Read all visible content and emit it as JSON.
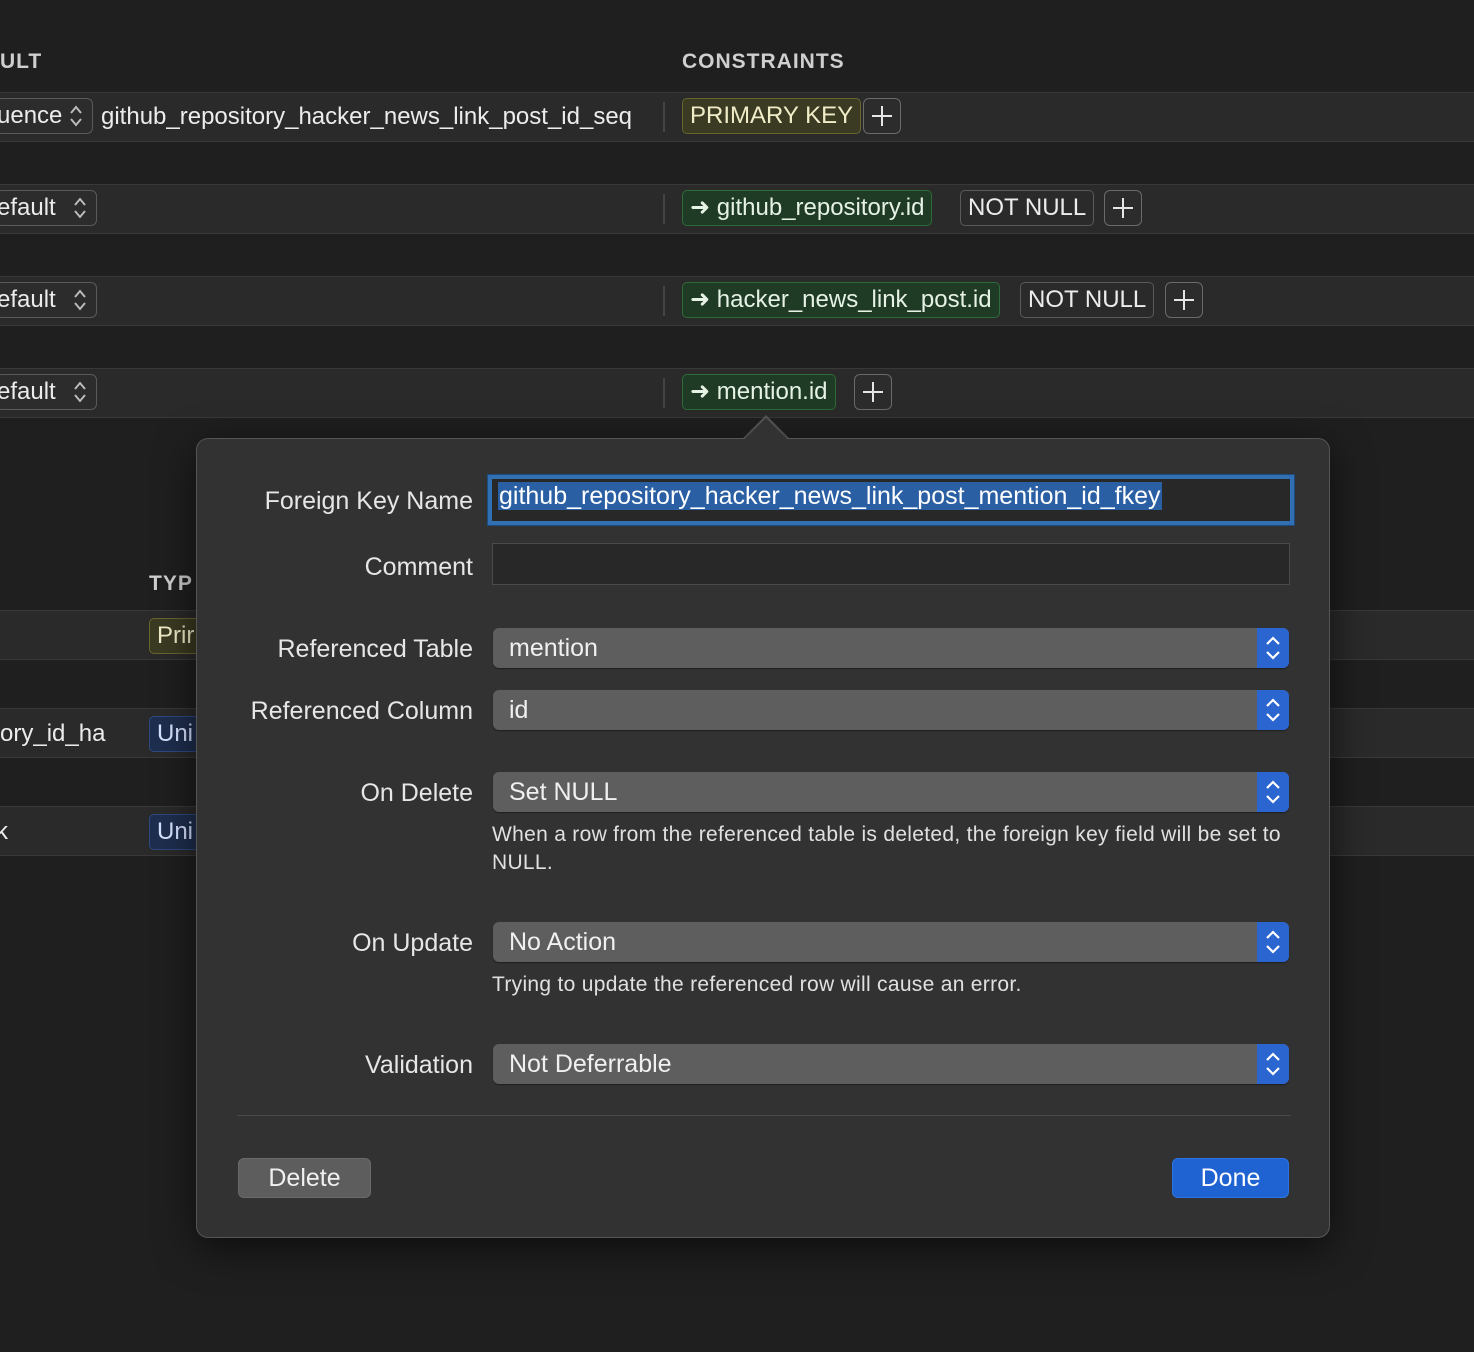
{
  "headers": {
    "default_col": "ULT",
    "constraints_col": "CONSTRAINTS",
    "type_col": "TYP"
  },
  "rows": [
    {
      "default_popup": "uence",
      "default_value": "github_repository_hacker_news_link_post_id_seq",
      "constraints": [
        {
          "kind": "pk",
          "label": "PRIMARY KEY"
        }
      ]
    },
    {
      "default_popup": "efault",
      "default_value": "",
      "constraints": [
        {
          "kind": "fk",
          "label": "➜ github_repository.id"
        },
        {
          "kind": "nn",
          "label": "NOT NULL"
        }
      ]
    },
    {
      "default_popup": "efault",
      "default_value": "",
      "constraints": [
        {
          "kind": "fk",
          "label": "➜ hacker_news_link_post.id"
        },
        {
          "kind": "nn",
          "label": "NOT NULL"
        }
      ]
    },
    {
      "default_popup": "efault",
      "default_value": "",
      "constraints": [
        {
          "kind": "fk",
          "label": "➜ mention.id"
        }
      ]
    }
  ],
  "indexes": {
    "rows": [
      {
        "name": "",
        "type": "Prir"
      },
      {
        "name": "ory_id_ha",
        "type": "Uni"
      },
      {
        "name": "k",
        "type": "Uni"
      }
    ]
  },
  "popover": {
    "fk_name_label": "Foreign Key Name",
    "fk_name_value": "github_repository_hacker_news_link_post_mention_id_fkey",
    "comment_label": "Comment",
    "comment_value": "",
    "ref_table_label": "Referenced Table",
    "ref_table_value": "mention",
    "ref_column_label": "Referenced Column",
    "ref_column_value": "id",
    "on_delete_label": "On Delete",
    "on_delete_value": "Set NULL",
    "on_delete_help": "When a row from the referenced table is deleted, the foreign key field will be set to NULL.",
    "on_update_label": "On Update",
    "on_update_value": "No Action",
    "on_update_help": "Trying to update the referenced row will cause an error.",
    "validation_label": "Validation",
    "validation_value": "Not Deferrable",
    "delete_button": "Delete",
    "done_button": "Done"
  },
  "colors": {
    "accent": "#1f63d2",
    "focus_ring": "#2f6fb2",
    "pk_chip": "#3b3a22",
    "fk_chip": "#1f3a25",
    "type_unique": "#1e2e4e"
  }
}
